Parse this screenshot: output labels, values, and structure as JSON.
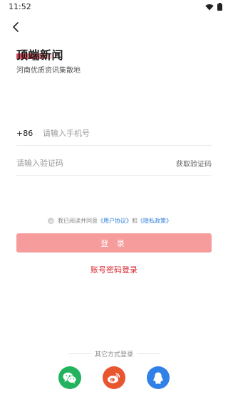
{
  "status_bar": {
    "time": "11:52"
  },
  "header": {
    "back_icon": "chevron-left-icon"
  },
  "brand": {
    "title": "顶端新闻",
    "subtitle": "河南优质资讯集散地",
    "accent_color": "#d7263a"
  },
  "phone": {
    "country_code": "+86",
    "placeholder": "请输入手机号",
    "value": ""
  },
  "code": {
    "placeholder": "请输入验证码",
    "value": "",
    "get_code_label": "获取验证码"
  },
  "agreement": {
    "prefix": "我已阅读并同意",
    "user_agreement": "《用户协议》",
    "and": "和",
    "privacy_policy": "《隐私政策》",
    "checked": false,
    "link_color": "#2f7fd8"
  },
  "login_button": {
    "label": "登 录",
    "color": "#f79c9c"
  },
  "password_login": {
    "label": "账号密码登录",
    "color": "#d7262f"
  },
  "other_login": {
    "label": "其它方式登录",
    "methods": [
      {
        "name": "wechat",
        "icon": "wechat-icon",
        "color": "#22b35e"
      },
      {
        "name": "weibo",
        "icon": "weibo-icon",
        "color": "#e8562f"
      },
      {
        "name": "qq",
        "icon": "qq-icon",
        "color": "#2f80e7"
      }
    ]
  }
}
